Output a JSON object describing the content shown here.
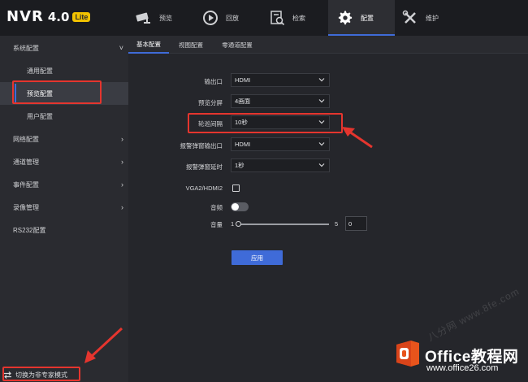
{
  "app": {
    "logo_main": "NVR",
    "logo_version": "4.0",
    "logo_badge": "Lite"
  },
  "topnav": [
    {
      "label": "预览",
      "icon": "camera-icon"
    },
    {
      "label": "回放",
      "icon": "play-circle-icon"
    },
    {
      "label": "检索",
      "icon": "search-doc-icon"
    },
    {
      "label": "配置",
      "icon": "gear-icon",
      "active": true
    },
    {
      "label": "维护",
      "icon": "tools-icon"
    }
  ],
  "sidebar": {
    "items": [
      {
        "label": "系统配置",
        "arrow": "˅"
      },
      {
        "label": "通用配置"
      },
      {
        "label": "预览配置",
        "selected": true
      },
      {
        "label": "用户配置"
      },
      {
        "label": "网络配置",
        "arrow": "›"
      },
      {
        "label": "通道管理",
        "arrow": "›"
      },
      {
        "label": "事件配置",
        "arrow": "›"
      },
      {
        "label": "录像管理",
        "arrow": "›"
      },
      {
        "label": "RS232配置"
      }
    ],
    "bottom_label": "切换为非专家模式"
  },
  "tabs": [
    {
      "label": "基本配置",
      "active": true
    },
    {
      "label": "视图配置"
    },
    {
      "label": "零通道配置"
    }
  ],
  "form": {
    "output_port": {
      "label": "输出口",
      "value": "HDMI"
    },
    "preview_split": {
      "label": "预览分屏",
      "value": "4画面"
    },
    "patrol_interval": {
      "label": "轮巡间隔",
      "value": "10秒"
    },
    "alarm_popup_output": {
      "label": "报警弹窗输出口",
      "value": "HDMI"
    },
    "alarm_popup_delay": {
      "label": "报警弹窗延时",
      "value": "1秒"
    },
    "vga_hdmi2": {
      "label": "VGA2/HDMI2",
      "checked": false
    },
    "audio": {
      "label": "音频",
      "on": false
    },
    "volume": {
      "label": "音量",
      "min": "1",
      "max": "5",
      "value": "0"
    },
    "apply_label": "应用"
  },
  "watermark": {
    "title": "Office教程网",
    "url": "www.office26.com",
    "diagonal": "八分网 www.8fe.com"
  },
  "colors": {
    "accent": "#3f6bd8",
    "annotation": "#e5352e",
    "badge": "#f2c200"
  }
}
